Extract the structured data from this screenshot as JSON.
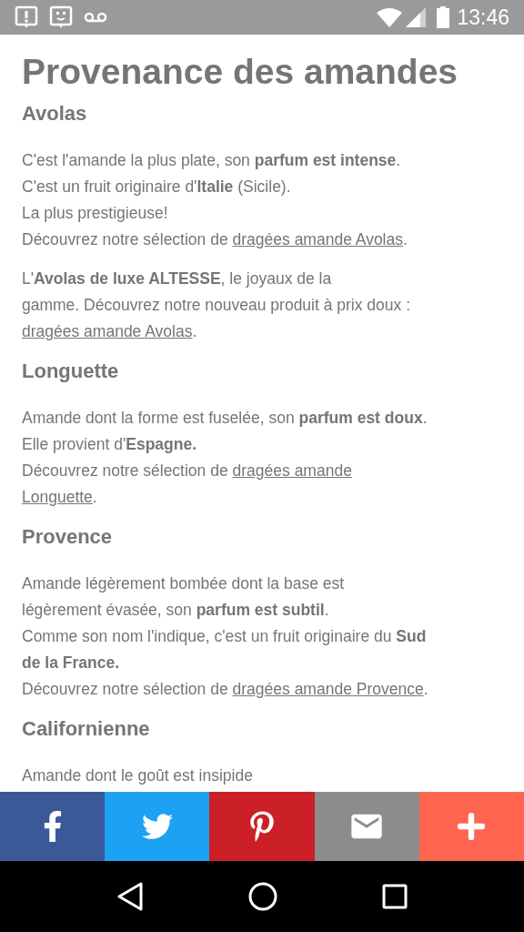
{
  "status_bar": {
    "time": "13:46"
  },
  "title": "Provenance des amandes",
  "sections": [
    {
      "heading": "Avolas",
      "paragraphs": [
        [
          [
            {
              "kind": "text",
              "text": "C'est l'amande la plus plate, son **parfum est intense**."
            }
          ],
          [
            {
              "kind": "text",
              "text": "C'est un fruit originaire d'**Italie** (Sicile)."
            }
          ],
          [
            {
              "kind": "text",
              "text": "La plus prestigieuse!"
            }
          ],
          [
            {
              "kind": "text",
              "text": "Découvrez notre sélection de "
            },
            {
              "kind": "link",
              "text": "dragées amande Avolas"
            },
            {
              "kind": "text",
              "text": "."
            }
          ]
        ],
        [
          [
            {
              "kind": "text",
              "text": "L'**Avolas de luxe ALTESSE**, le joyaux de la"
            }
          ],
          [
            {
              "kind": "text",
              "text": "gamme. Découvrez notre nouveau produit à prix doux :"
            }
          ],
          [
            {
              "kind": "link",
              "text": "dragées amande Avolas"
            },
            {
              "kind": "text",
              "text": "."
            }
          ]
        ]
      ]
    },
    {
      "heading": "Longuette",
      "paragraphs": [
        [
          [
            {
              "kind": "text",
              "text": "Amande dont la forme est fuselée, son **parfum est doux**."
            }
          ],
          [
            {
              "kind": "text",
              "text": "Elle provient d'**Espagne.**"
            }
          ],
          [
            {
              "kind": "text",
              "text": "Découvrez notre sélection de "
            },
            {
              "kind": "link",
              "text": "dragées amande"
            }
          ],
          [
            {
              "kind": "link",
              "text": "Longuette"
            },
            {
              "kind": "text",
              "text": "."
            }
          ]
        ]
      ]
    },
    {
      "heading": "Provence",
      "paragraphs": [
        [
          [
            {
              "kind": "text",
              "text": "Amande légèrement bombée dont la base est"
            }
          ],
          [
            {
              "kind": "text",
              "text": "légèrement évasée, son **parfum est subtil**."
            }
          ],
          [
            {
              "kind": "text",
              "text": "Comme son nom l'indique, c'est un fruit originaire du **Sud**"
            }
          ],
          [
            {
              "kind": "text",
              "text": "**de la France.**"
            }
          ],
          [
            {
              "kind": "text",
              "text": "Découvrez notre sélection de "
            },
            {
              "kind": "link",
              "text": "dragées amande Provence"
            },
            {
              "kind": "text",
              "text": "."
            }
          ]
        ]
      ]
    },
    {
      "heading": "Californienne",
      "paragraphs": [
        [
          [
            {
              "kind": "text",
              "text": "Amande dont le goût est insipide"
            }
          ]
        ]
      ]
    }
  ],
  "share_buttons": [
    {
      "kind": "facebook",
      "color": "#3b5998"
    },
    {
      "kind": "twitter",
      "color": "#1da1f2"
    },
    {
      "kind": "pinterest",
      "color": "#cb2027"
    },
    {
      "kind": "email",
      "color": "#8c8c8c"
    },
    {
      "kind": "more",
      "color": "#ff6550"
    }
  ]
}
